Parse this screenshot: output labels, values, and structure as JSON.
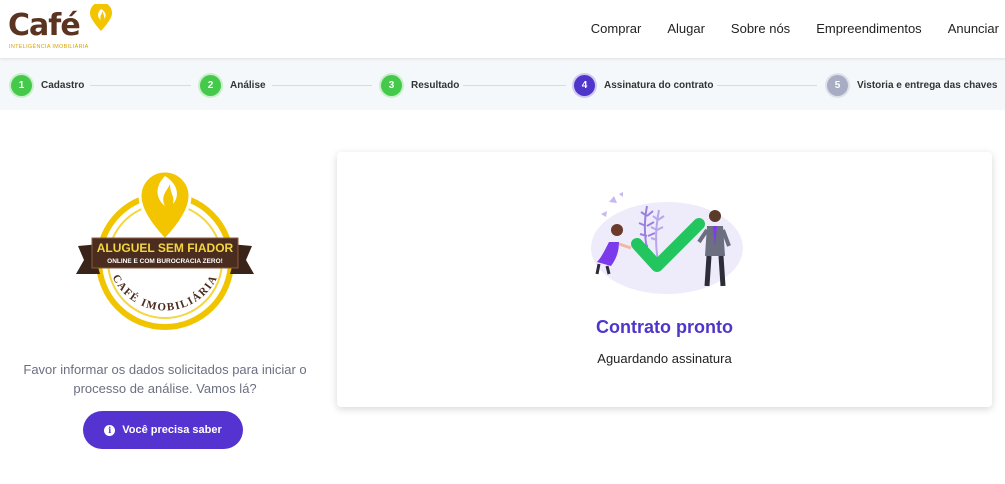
{
  "header": {
    "logo_text": "Café",
    "logo_tagline": "INTELIGÊNCIA IMOBILIÁRIA",
    "nav": [
      "Comprar",
      "Alugar",
      "Sobre nós",
      "Empreendimentos",
      "Anunciar"
    ]
  },
  "stepper": {
    "steps": [
      {
        "num": "1",
        "label": "Cadastro",
        "state": "done"
      },
      {
        "num": "2",
        "label": "Análise",
        "state": "done"
      },
      {
        "num": "3",
        "label": "Resultado",
        "state": "done"
      },
      {
        "num": "4",
        "label": "Assinatura do contrato",
        "state": "active"
      },
      {
        "num": "5",
        "label": "Vistoria e entrega das chaves",
        "state": "pending"
      }
    ]
  },
  "left": {
    "badge_banner_main": "ALUGUEL SEM FIADOR",
    "badge_banner_sub": "ONLINE E COM BUROCRACIA ZERO!",
    "badge_ring_text": "CAFÉ IMOBILIÁRIA",
    "info_text": "Favor informar os dados solicitados para iniciar o processo de análise. Vamos lá?",
    "button_label": "Você precisa saber"
  },
  "card": {
    "title": "Contrato pronto",
    "subtitle": "Aguardando assinatura"
  },
  "colors": {
    "brand_brown": "#5a3420",
    "brand_yellow": "#e8b800",
    "primary_purple": "#4f35c9",
    "step_done": "#44c94a",
    "step_pending": "#a9adc4"
  }
}
